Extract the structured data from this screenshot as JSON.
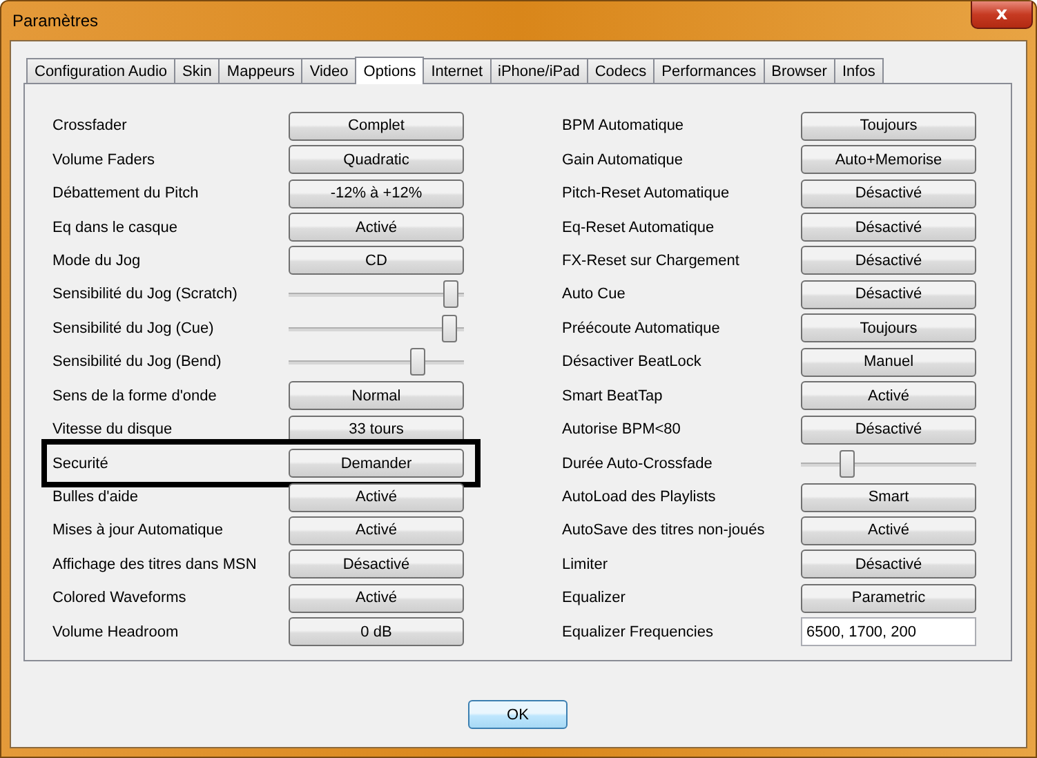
{
  "window": {
    "title": "Paramètres",
    "close": "x"
  },
  "tabs": [
    {
      "label": "Configuration Audio",
      "selected": false
    },
    {
      "label": "Skin",
      "selected": false
    },
    {
      "label": "Mappeurs",
      "selected": false
    },
    {
      "label": "Video",
      "selected": false
    },
    {
      "label": "Options",
      "selected": true
    },
    {
      "label": "Internet",
      "selected": false
    },
    {
      "label": "iPhone/iPad",
      "selected": false
    },
    {
      "label": "Codecs",
      "selected": false
    },
    {
      "label": "Performances",
      "selected": false
    },
    {
      "label": "Browser",
      "selected": false
    },
    {
      "label": "Infos",
      "selected": false
    }
  ],
  "left_settings": [
    {
      "label": "Crossfader",
      "kind": "button",
      "value": "Complet",
      "highlighted": false
    },
    {
      "label": "Volume Faders",
      "kind": "button",
      "value": "Quadratic",
      "highlighted": false
    },
    {
      "label": "Débattement du Pitch",
      "kind": "button",
      "value": "-12% à +12%",
      "highlighted": false
    },
    {
      "label": "Eq dans le casque",
      "kind": "button",
      "value": "Activé",
      "highlighted": false
    },
    {
      "label": "Mode du Jog",
      "kind": "button",
      "value": "CD",
      "highlighted": false
    },
    {
      "label": "Sensibilité du Jog (Scratch)",
      "kind": "slider",
      "level": 0.92,
      "highlighted": false
    },
    {
      "label": "Sensibilité du Jog (Cue)",
      "kind": "slider",
      "level": 0.91,
      "highlighted": false
    },
    {
      "label": "Sensibilité du Jog (Bend)",
      "kind": "slider",
      "level": 0.73,
      "highlighted": false
    },
    {
      "label": "Sens de la forme d'onde",
      "kind": "button",
      "value": "Normal",
      "highlighted": false
    },
    {
      "label": "Vitesse du disque",
      "kind": "button",
      "value": "33 tours",
      "highlighted": false
    },
    {
      "label": "Securité",
      "kind": "button",
      "value": "Demander",
      "highlighted": true
    },
    {
      "label": "Bulles d'aide",
      "kind": "button",
      "value": "Activé",
      "highlighted": false
    },
    {
      "label": "Mises à jour Automatique",
      "kind": "button",
      "value": "Activé",
      "highlighted": false
    },
    {
      "label": "Affichage des titres dans MSN",
      "kind": "button",
      "value": "Désactivé",
      "highlighted": false
    },
    {
      "label": "Colored Waveforms",
      "kind": "button",
      "value": "Activé",
      "highlighted": false
    },
    {
      "label": "Volume Headroom",
      "kind": "button",
      "value": "0 dB",
      "highlighted": false
    }
  ],
  "right_settings": [
    {
      "label": "BPM Automatique",
      "kind": "button",
      "value": "Toujours",
      "highlighted": false
    },
    {
      "label": "Gain Automatique",
      "kind": "button",
      "value": "Auto+Memorise",
      "highlighted": false
    },
    {
      "label": "Pitch-Reset Automatique",
      "kind": "button",
      "value": "Désactivé",
      "highlighted": false
    },
    {
      "label": "Eq-Reset Automatique",
      "kind": "button",
      "value": "Désactivé",
      "highlighted": false
    },
    {
      "label": "FX-Reset sur Chargement",
      "kind": "button",
      "value": "Désactivé",
      "highlighted": false
    },
    {
      "label": "Auto Cue",
      "kind": "button",
      "value": "Désactivé",
      "highlighted": false
    },
    {
      "label": "Préécoute Automatique",
      "kind": "button",
      "value": "Toujours",
      "highlighted": false
    },
    {
      "label": "Désactiver BeatLock",
      "kind": "button",
      "value": "Manuel",
      "highlighted": false
    },
    {
      "label": "Smart BeatTap",
      "kind": "button",
      "value": "Activé",
      "highlighted": false
    },
    {
      "label": "Autorise BPM<80",
      "kind": "button",
      "value": "Désactivé",
      "highlighted": false
    },
    {
      "label": "Durée Auto-Crossfade",
      "kind": "slider",
      "level": 0.26,
      "highlighted": false
    },
    {
      "label": "AutoLoad des Playlists",
      "kind": "button",
      "value": "Smart",
      "highlighted": false
    },
    {
      "label": "AutoSave des titres non-joués",
      "kind": "button",
      "value": "Activé",
      "highlighted": false
    },
    {
      "label": "Limiter",
      "kind": "button",
      "value": "Désactivé",
      "highlighted": false
    },
    {
      "label": "Equalizer",
      "kind": "button",
      "value": "Parametric",
      "highlighted": false
    },
    {
      "label": "Equalizer Frequencies",
      "kind": "field",
      "value": "6500, 1700, 200",
      "highlighted": false
    }
  ],
  "buttons": [
    "OK"
  ]
}
